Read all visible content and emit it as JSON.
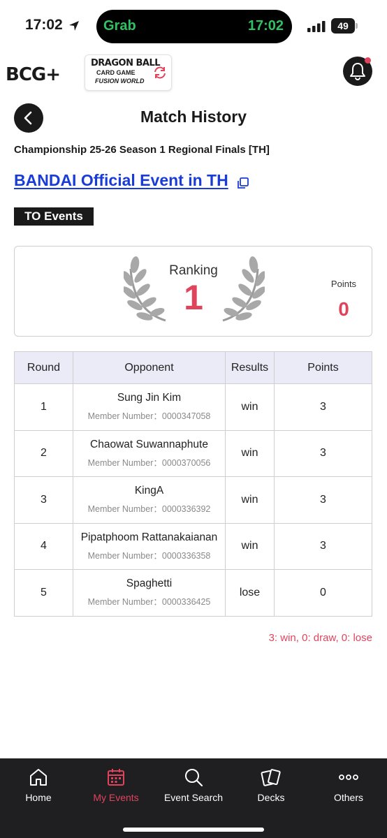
{
  "status_bar": {
    "time": "17:02",
    "island_app": "Grab",
    "island_time": "17:02",
    "battery": "49"
  },
  "header": {
    "brand_logo": "BCG+",
    "game_logo_line1": "DRAGON BALL",
    "game_logo_line2": "CARD GAME",
    "game_logo_line3": "FUSION WORLD",
    "notification_icon": "bell-icon"
  },
  "page": {
    "title": "Match History",
    "event_name": "Championship 25-26 Season 1 Regional Finals [TH]",
    "organizer_link": "BANDAI Official Event in TH",
    "event_type_badge": "TO Events"
  },
  "ranking": {
    "label": "Ranking",
    "value": "1",
    "points_label": "Points",
    "points_value": "0"
  },
  "table": {
    "headers": {
      "round": "Round",
      "opponent": "Opponent",
      "results": "Results",
      "points": "Points"
    },
    "rows": [
      {
        "round": "1",
        "opponent": "Sung Jin Kim",
        "member": "Member Number：0000347058",
        "result": "win",
        "points": "3"
      },
      {
        "round": "2",
        "opponent": "Chaowat Suwannaphute",
        "member": "Member Number：0000370056",
        "result": "win",
        "points": "3"
      },
      {
        "round": "3",
        "opponent": "KingA",
        "member": "Member Number：0000336392",
        "result": "win",
        "points": "3"
      },
      {
        "round": "4",
        "opponent": "Pipatphoom Rattanakaianan",
        "member": "Member Number：0000336358",
        "result": "win",
        "points": "3"
      },
      {
        "round": "5",
        "opponent": "Spaghetti",
        "member": "Member Number：0000336425",
        "result": "lose",
        "points": "0"
      }
    ]
  },
  "legend": "3: win, 0: draw, 0: lose",
  "colors": {
    "accent": "#e0445d",
    "link": "#1a3cd6",
    "nav_background": "#1f1f22",
    "table_header": "#ebebf8"
  },
  "bottom_nav": {
    "items": [
      {
        "label": "Home",
        "icon": "home-icon"
      },
      {
        "label": "My Events",
        "icon": "calendar-icon",
        "active": true
      },
      {
        "label": "Event Search",
        "icon": "search-icon"
      },
      {
        "label": "Decks",
        "icon": "cards-icon"
      },
      {
        "label": "Others",
        "icon": "more-icon"
      }
    ]
  }
}
